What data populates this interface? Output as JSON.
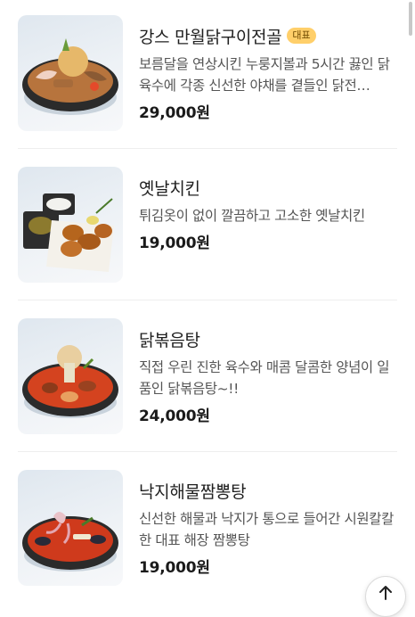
{
  "menu": {
    "items": [
      {
        "name": "강스 만월닭구이전골",
        "badge": "대표",
        "description": "보름달을 연상시킨 누룽지볼과 5시간 끓인 닭육수에 각종 신선한 야채를 곁들인 닭전…",
        "price": "29,000원",
        "image_icon": "hotpot-image"
      },
      {
        "name": "옛날치킨",
        "badge": "",
        "description": "튀김옷이 없이 깔끔하고 고소한 옛날치킨",
        "price": "19,000원",
        "image_icon": "fried-chicken-image"
      },
      {
        "name": "닭볶음탕",
        "badge": "",
        "description": "직접 우린 진한 육수와 매콤 달콤한 양념이 일품인 닭볶음탕~!!",
        "price": "24,000원",
        "image_icon": "spicy-stew-image"
      },
      {
        "name": "낙지해물짬뽕탕",
        "badge": "",
        "description": "신선한 해물과 낙지가 통으로 들어간 시원칼칼한 대표 해장 짬뽕탕",
        "price": "19,000원",
        "image_icon": "seafood-stew-image"
      }
    ]
  },
  "scroll_top_button": {
    "icon": "arrow-up-icon"
  },
  "colors": {
    "badge_bg": "#ffcf6a",
    "badge_text": "#6e4a00"
  }
}
